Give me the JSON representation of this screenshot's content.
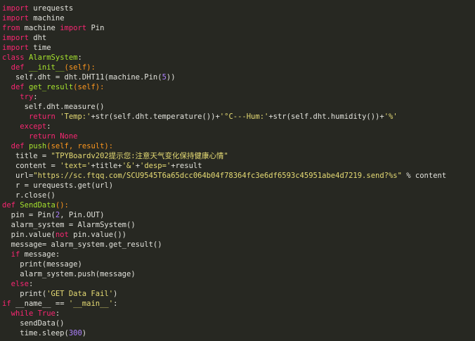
{
  "editor": {
    "language": "python",
    "lines": [
      [
        [
          "k",
          "import"
        ],
        [
          "t",
          " urequests"
        ]
      ],
      [
        [
          "k",
          "import"
        ],
        [
          "t",
          " machine"
        ]
      ],
      [
        [
          "k",
          "from"
        ],
        [
          "t",
          " machine "
        ],
        [
          "k",
          "import"
        ],
        [
          "t",
          " Pin"
        ]
      ],
      [
        [
          "k",
          "import"
        ],
        [
          "t",
          " dht"
        ]
      ],
      [
        [
          "k",
          "import"
        ],
        [
          "t",
          " time"
        ]
      ],
      [
        [
          "k",
          "class"
        ],
        [
          "t",
          " "
        ],
        [
          "f",
          "AlarmSystem"
        ],
        [
          "t",
          ":"
        ]
      ],
      [
        [
          "t",
          "  "
        ],
        [
          "k",
          "def"
        ],
        [
          "t",
          " "
        ],
        [
          "f",
          "__init__"
        ],
        [
          "p",
          "(self):"
        ]
      ],
      [
        [
          "t",
          "   self.dht = dht.DHT11(machine.Pin("
        ],
        [
          "n",
          "5"
        ],
        [
          "t",
          "))"
        ]
      ],
      [
        [
          "t",
          "  "
        ],
        [
          "k",
          "def"
        ],
        [
          "t",
          " "
        ],
        [
          "f",
          "get_result"
        ],
        [
          "p",
          "(self):"
        ]
      ],
      [
        [
          "t",
          "    "
        ],
        [
          "k",
          "try"
        ],
        [
          "t",
          ":"
        ]
      ],
      [
        [
          "t",
          "     self.dht.measure()"
        ]
      ],
      [
        [
          "t",
          "      "
        ],
        [
          "k",
          "return"
        ],
        [
          "t",
          " "
        ],
        [
          "s",
          "'Temp:'"
        ],
        [
          "t",
          "+str(self.dht.temperature())+"
        ],
        [
          "s",
          "'°C---Hum:'"
        ],
        [
          "t",
          "+str(self.dht.humidity())+"
        ],
        [
          "s",
          "'%'"
        ]
      ],
      [
        [
          "t",
          "    "
        ],
        [
          "k",
          "except"
        ],
        [
          "t",
          ":"
        ]
      ],
      [
        [
          "t",
          "      "
        ],
        [
          "k",
          "return"
        ],
        [
          "t",
          " "
        ],
        [
          "k",
          "None"
        ]
      ],
      [
        [
          "t",
          "  "
        ],
        [
          "k",
          "def"
        ],
        [
          "t",
          " "
        ],
        [
          "f",
          "push"
        ],
        [
          "p",
          "(self, result):"
        ]
      ],
      [
        [
          "t",
          "   title = "
        ],
        [
          "s",
          "\"TPYBoardv202提示您:注意天气变化保持健康心情\""
        ]
      ],
      [
        [
          "t",
          "   content = "
        ],
        [
          "s",
          "'text='"
        ],
        [
          "t",
          "+title+"
        ],
        [
          "s",
          "'&'"
        ],
        [
          "t",
          "+"
        ],
        [
          "s",
          "'desp='"
        ],
        [
          "t",
          "+result"
        ]
      ],
      [
        [
          "t",
          "   url="
        ],
        [
          "s",
          "\"https://sc.ftqq.com/SCU9545T6a65dcc064b04f78364fc3e6df6593c45951abe4d7219.send?%s\""
        ],
        [
          "t",
          " % content"
        ]
      ],
      [
        [
          "t",
          "   r = urequests.get(url)"
        ]
      ],
      [
        [
          "t",
          "   r.close()"
        ]
      ],
      [
        [
          "k",
          "def"
        ],
        [
          "t",
          " "
        ],
        [
          "f",
          "SendData"
        ],
        [
          "p",
          "():"
        ]
      ],
      [
        [
          "t",
          "  pin = Pin("
        ],
        [
          "n",
          "2"
        ],
        [
          "t",
          ", Pin.OUT)"
        ]
      ],
      [
        [
          "t",
          "  alarm_system = AlarmSystem()"
        ]
      ],
      [
        [
          "t",
          "  pin.value("
        ],
        [
          "k",
          "not"
        ],
        [
          "t",
          " pin.value())"
        ]
      ],
      [
        [
          "t",
          "  message= alarm_system.get_result()"
        ]
      ],
      [
        [
          "t",
          "  "
        ],
        [
          "k",
          "if"
        ],
        [
          "t",
          " message:"
        ]
      ],
      [
        [
          "t",
          "    print(message)"
        ]
      ],
      [
        [
          "t",
          "    alarm_system.push(message)"
        ]
      ],
      [
        [
          "t",
          "  "
        ],
        [
          "k",
          "else"
        ],
        [
          "t",
          ":"
        ]
      ],
      [
        [
          "t",
          "    print("
        ],
        [
          "s",
          "'GET Data Fail'"
        ],
        [
          "t",
          ")"
        ]
      ],
      [
        [
          "k",
          "if"
        ],
        [
          "t",
          " __name__ == "
        ],
        [
          "s",
          "'__main__'"
        ],
        [
          "t",
          ":"
        ]
      ],
      [
        [
          "t",
          "  "
        ],
        [
          "k",
          "while"
        ],
        [
          "t",
          " "
        ],
        [
          "k",
          "True"
        ],
        [
          "t",
          ":"
        ]
      ],
      [
        [
          "t",
          "    sendData()"
        ]
      ],
      [
        [
          "t",
          "    time.sleep("
        ],
        [
          "n",
          "300"
        ],
        [
          "t",
          ")"
        ]
      ]
    ]
  }
}
